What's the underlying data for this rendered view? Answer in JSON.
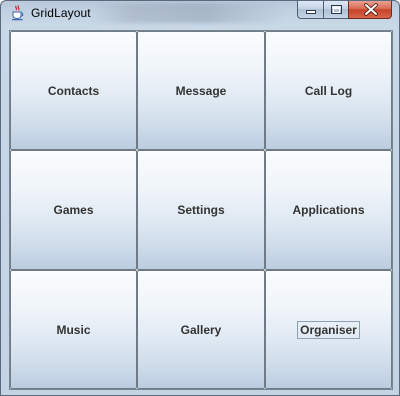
{
  "window": {
    "title": "GridLayout",
    "icon": "java-coffee-cup-icon",
    "controls": [
      "minimize-icon",
      "maximize-icon",
      "close-icon"
    ]
  },
  "grid": {
    "rows": 3,
    "columns": 3,
    "buttons": [
      {
        "label": "Contacts"
      },
      {
        "label": "Message"
      },
      {
        "label": "Call Log"
      },
      {
        "label": "Games"
      },
      {
        "label": "Settings"
      },
      {
        "label": "Applications"
      },
      {
        "label": "Music"
      },
      {
        "label": "Gallery"
      },
      {
        "label": "Organiser",
        "focused": true
      }
    ]
  },
  "colors": {
    "button_border": "#707b87",
    "button_text": "#333333",
    "close_button": "#c6432a",
    "title_bar": "#c2d2e3"
  }
}
